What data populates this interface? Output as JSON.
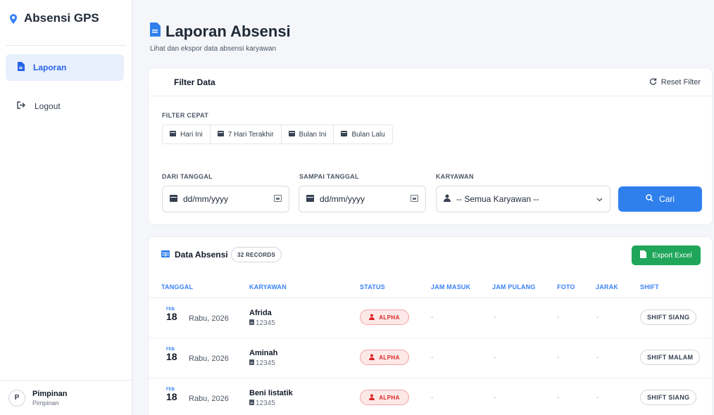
{
  "brand": {
    "title": "Absensi GPS"
  },
  "sidebar": {
    "items": [
      {
        "label": "Laporan"
      },
      {
        "label": "Logout"
      }
    ],
    "user": {
      "initial": "P",
      "name": "Pimpinan",
      "role": "Pimpinan"
    }
  },
  "header": {
    "title": "Laporan Absensi",
    "subtitle": "Lihat dan ekspor data absensi karyawan"
  },
  "filter": {
    "title": "Filter Data",
    "reset_label": "Reset Filter",
    "quick_label": "FILTER CEPAT",
    "quick": [
      "Hari Ini",
      "7 Hari Terakhir",
      "Bulan Ini",
      "Bulan Lalu"
    ],
    "from_label": "DARI TANGGAL",
    "from_placeholder": "dd/mm/yyyy",
    "to_label": "SAMPAI TANGGAL",
    "to_placeholder": "dd/mm/yyyy",
    "employee_label": "KARYAWAN",
    "employee_value": "-- Semua Karyawan --",
    "search_label": "Cari"
  },
  "data": {
    "title": "Data Absensi",
    "records": "32 RECORDS",
    "export_label": "Export Excel",
    "columns": [
      "TANGGAL",
      "KARYAWAN",
      "STATUS",
      "JAM MASUK",
      "JAM PULANG",
      "FOTO",
      "JARAK",
      "SHIFT"
    ],
    "rows": [
      {
        "month": "FEB",
        "day": "18",
        "dayname": "Rabu, 2026",
        "name": "Afrida",
        "id": "12345",
        "status": "ALPHA",
        "in": "-",
        "out": "-",
        "photo": "-",
        "distance": "-",
        "shift": "SHIFT SIANG"
      },
      {
        "month": "FEB",
        "day": "18",
        "dayname": "Rabu, 2026",
        "name": "Aminah",
        "id": "12345",
        "status": "ALPHA",
        "in": "-",
        "out": "-",
        "photo": "-",
        "distance": "-",
        "shift": "SHIFT MALAM"
      },
      {
        "month": "FEB",
        "day": "18",
        "dayname": "Rabu, 2026",
        "name": "Beni listatik",
        "id": "12345",
        "status": "ALPHA",
        "in": "-",
        "out": "-",
        "photo": "-",
        "distance": "-",
        "shift": "SHIFT SIANG"
      }
    ]
  },
  "colors": {
    "accent": "#2f80ed",
    "success": "#1fa65a",
    "danger": "#dc2626",
    "sidebar_active_bg": "#e8f0fd"
  }
}
